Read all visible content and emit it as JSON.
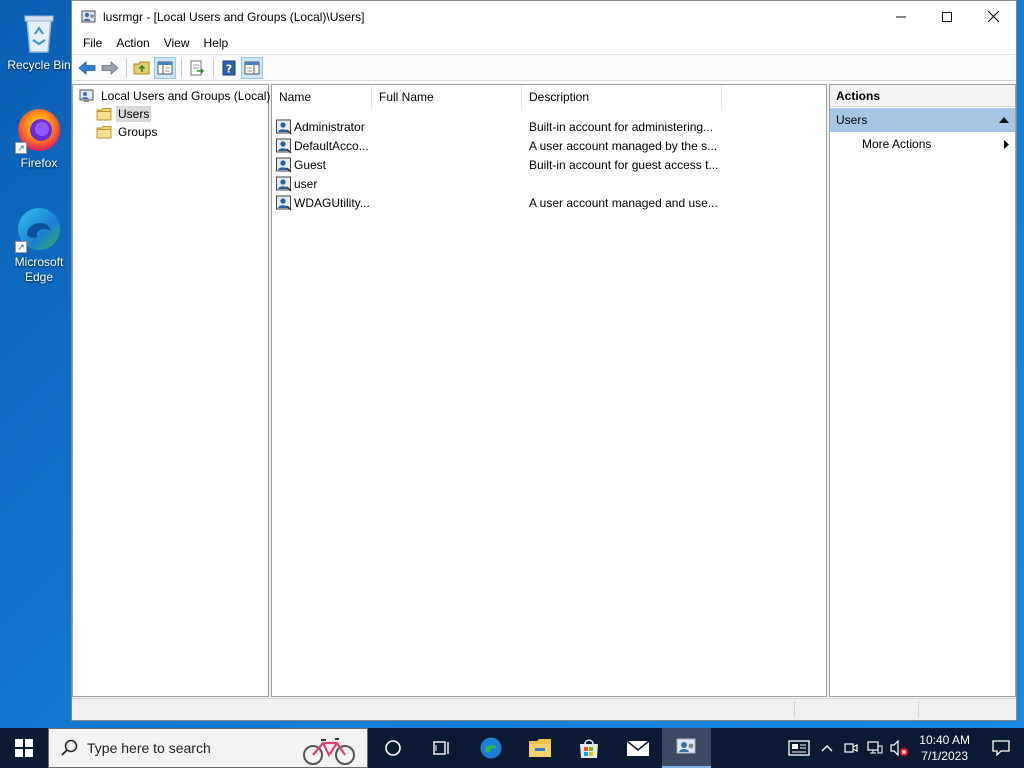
{
  "desktop": {
    "icons": [
      {
        "label": "Recycle Bin"
      },
      {
        "label": "Firefox"
      },
      {
        "label": "Microsoft Edge"
      }
    ]
  },
  "window": {
    "title": "lusrmgr - [Local Users and Groups (Local)\\Users]",
    "menu": [
      "File",
      "Action",
      "View",
      "Help"
    ]
  },
  "tree": {
    "root": "Local Users and Groups (Local)",
    "children": [
      "Users",
      "Groups"
    ],
    "selected": "Users"
  },
  "list": {
    "columns": [
      "Name",
      "Full Name",
      "Description"
    ],
    "rows": [
      {
        "name": "Administrator",
        "full_name": "",
        "description": "Built-in account for administering..."
      },
      {
        "name": "DefaultAcco...",
        "full_name": "",
        "description": "A user account managed by the s..."
      },
      {
        "name": "Guest",
        "full_name": "",
        "description": "Built-in account for guest access t..."
      },
      {
        "name": "user",
        "full_name": "",
        "description": ""
      },
      {
        "name": "WDAGUtility...",
        "full_name": "",
        "description": "A user account managed and use..."
      }
    ]
  },
  "actions": {
    "header": "Actions",
    "section": "Users",
    "items": [
      "More Actions"
    ]
  },
  "taskbar": {
    "search_placeholder": "Type here to search",
    "time": "10:40 AM",
    "date": "7/1/2023"
  },
  "colors": {
    "desktop": "#0a5fb4",
    "taskbar": "#0b1a33",
    "actions_section": "#a6c6e6",
    "selection": "#d9d9d9"
  }
}
